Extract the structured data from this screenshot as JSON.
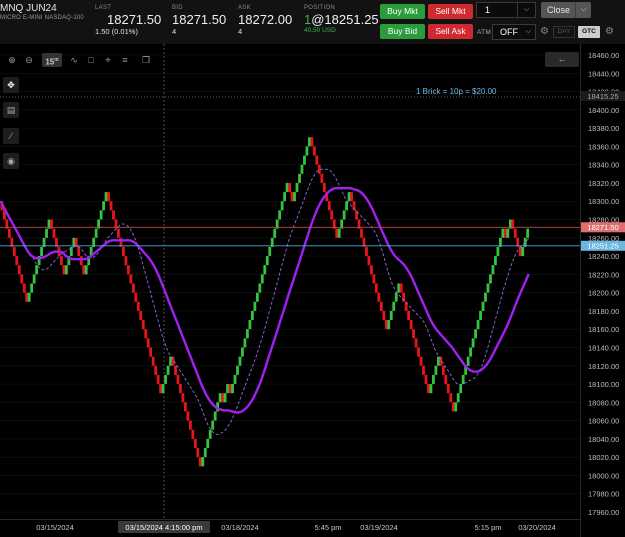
{
  "header": {
    "symbol": "MNQ JUN24",
    "description": "MICRO E-MINI NASDAQ-100",
    "last_label": "LAST",
    "last_value": "18271.50",
    "last_change": "1.50 (0.01%)",
    "bid_label": "BID",
    "bid_value": "18271.50",
    "bid_size": "4",
    "ask_label": "ASK",
    "ask_value": "18272.00",
    "ask_size": "4",
    "position_label": "POSITION",
    "position_qty": "1",
    "position_price": "@18251.25",
    "position_pnl": "40.50 USD"
  },
  "order": {
    "buy_mkt": "Buy Mkt",
    "sell_mkt": "Sell Mkt",
    "buy_bid": "Buy Bid",
    "sell_ask": "Sell Ask",
    "quantity": "1",
    "close_label": "Close",
    "atm_label": "ATM",
    "atm_value": "OFF",
    "day_label": "DAY",
    "gtc_label": "GTC"
  },
  "toolbar": {
    "timeframe": "15",
    "timeframe_unit": "m"
  },
  "chart": {
    "brick_label": "1 Brick = 10p = $20.00",
    "last_price_tag": "18271.50",
    "position_price_tag": "18251.25",
    "top_price_tag": "18415.25",
    "crosshair_time": "03/15/2024 4:15:00 pm",
    "x_labels": [
      "03/15/2024",
      "03/18/2024",
      "5:45 pm",
      "03/19/2024",
      "5:15 pm",
      "03/20/2024"
    ],
    "colors": {
      "up": "#35c43f",
      "down": "#e8161a",
      "ma_solid": "#a020f0",
      "ma_dashed": "#8a6fe8",
      "last_line": "#c44d4d",
      "position_line": "#4fa8d8",
      "position_tag": "#6cb7e2",
      "last_tag": "#e07070"
    }
  },
  "chart_data": {
    "type": "line",
    "title": "",
    "xlabel": "",
    "ylabel": "",
    "ylim": [
      17960,
      18460
    ],
    "y_ticks": [
      17960,
      17980,
      18000,
      18020,
      18040,
      18060,
      18080,
      18100,
      18120,
      18140,
      18160,
      18180,
      18200,
      18220,
      18240,
      18260,
      18280,
      18300,
      18320,
      18340,
      18360,
      18380,
      18400,
      18420,
      18440,
      18460
    ],
    "brick_size": 10,
    "series": [
      {
        "kind": "renko",
        "points": [
          18300,
          18290,
          18280,
          18270,
          18260,
          18250,
          18240,
          18230,
          18220,
          18210,
          18200,
          18190,
          18200,
          18210,
          18220,
          18230,
          18240,
          18250,
          18260,
          18270,
          18280,
          18270,
          18260,
          18250,
          18240,
          18230,
          18220,
          18230,
          18240,
          18250,
          18260,
          18250,
          18240,
          18230,
          18220,
          18230,
          18240,
          18250,
          18260,
          18270,
          18280,
          18290,
          18300,
          18310,
          18300,
          18290,
          18280,
          18270,
          18260,
          18250,
          18240,
          18230,
          18220,
          18210,
          18200,
          18190,
          18180,
          18170,
          18160,
          18150,
          18140,
          18130,
          18120,
          18110,
          18100,
          18090,
          18100,
          18110,
          18120,
          18130,
          18120,
          18110,
          18100,
          18090,
          18080,
          18070,
          18060,
          18050,
          18040,
          18030,
          18020,
          18010,
          18020,
          18030,
          18040,
          18050,
          18060,
          18070,
          18080,
          18090,
          18080,
          18090,
          18100,
          18090,
          18100,
          18110,
          18120,
          18130,
          18140,
          18150,
          18160,
          18170,
          18180,
          18190,
          18200,
          18210,
          18220,
          18230,
          18240,
          18250,
          18260,
          18270,
          18280,
          18290,
          18300,
          18310,
          18320,
          18310,
          18300,
          18310,
          18320,
          18330,
          18340,
          18350,
          18360,
          18370,
          18360,
          18350,
          18340,
          18330,
          18320,
          18310,
          18300,
          18290,
          18280,
          18270,
          18260,
          18270,
          18280,
          18290,
          18300,
          18310,
          18300,
          18290,
          18280,
          18270,
          18260,
          18250,
          18240,
          18230,
          18220,
          18210,
          18200,
          18190,
          18180,
          18170,
          18160,
          18170,
          18180,
          18190,
          18200,
          18210,
          18200,
          18190,
          18180,
          18170,
          18160,
          18150,
          18140,
          18130,
          18120,
          18110,
          18100,
          18090,
          18100,
          18110,
          18120,
          18130,
          18120,
          18110,
          18100,
          18090,
          18080,
          18070,
          18080,
          18090,
          18100,
          18110,
          18120,
          18130,
          18140,
          18150,
          18160,
          18170,
          18180,
          18190,
          18200,
          18210,
          18220,
          18230,
          18240,
          18250,
          18260,
          18270,
          18260,
          18270,
          18280,
          18270,
          18260,
          18250,
          18240,
          18250,
          18260,
          18270
        ]
      }
    ]
  }
}
